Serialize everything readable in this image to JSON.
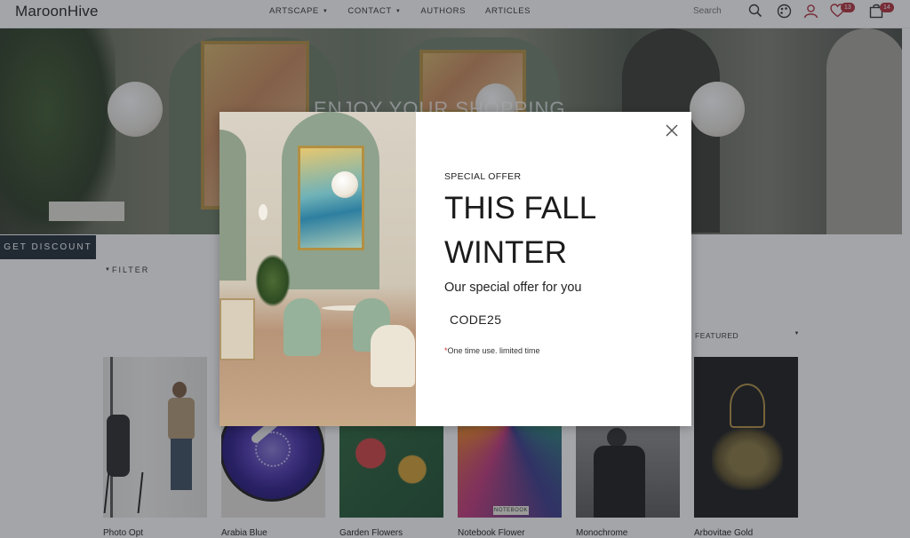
{
  "header": {
    "logo": "MaroonHive",
    "nav": [
      {
        "label": "ARTSCAPE",
        "has_dropdown": true
      },
      {
        "label": "CONTACT",
        "has_dropdown": true
      },
      {
        "label": "AUTHORS",
        "has_dropdown": false
      },
      {
        "label": "ARTICLES",
        "has_dropdown": false
      }
    ],
    "search_placeholder": "Search",
    "wishlist_count": "13",
    "cart_count": "14",
    "icons": [
      "search-icon",
      "palette-icon",
      "user-icon",
      "heart-icon",
      "cart-icon"
    ]
  },
  "hero": {
    "headline": "ENJOY YOUR SHOPPING",
    "cta": "GET DISCOUNT"
  },
  "filters": {
    "filter_label": "FILTER",
    "sort_label": "FEATURED"
  },
  "products": [
    {
      "name": "Photo Opt"
    },
    {
      "name": "Arabia Blue"
    },
    {
      "name": "Garden Flowers"
    },
    {
      "name": "Notebook Flower"
    },
    {
      "name": "Monochrome"
    },
    {
      "name": "Arbovitae Gold"
    }
  ],
  "notebook_cover_text": "NOTEBOOK",
  "modal": {
    "eyebrow": "SPECIAL OFFER",
    "headline": "THIS FALL WINTER",
    "subheading": "Our special offer for you",
    "code": "CODE25",
    "note_mark": "*",
    "note": "One time use. limited time"
  },
  "colors": {
    "accent": "#b3303a",
    "cta_background": "#1f2b34",
    "overlay": "rgba(35,40,50,0.42)"
  }
}
